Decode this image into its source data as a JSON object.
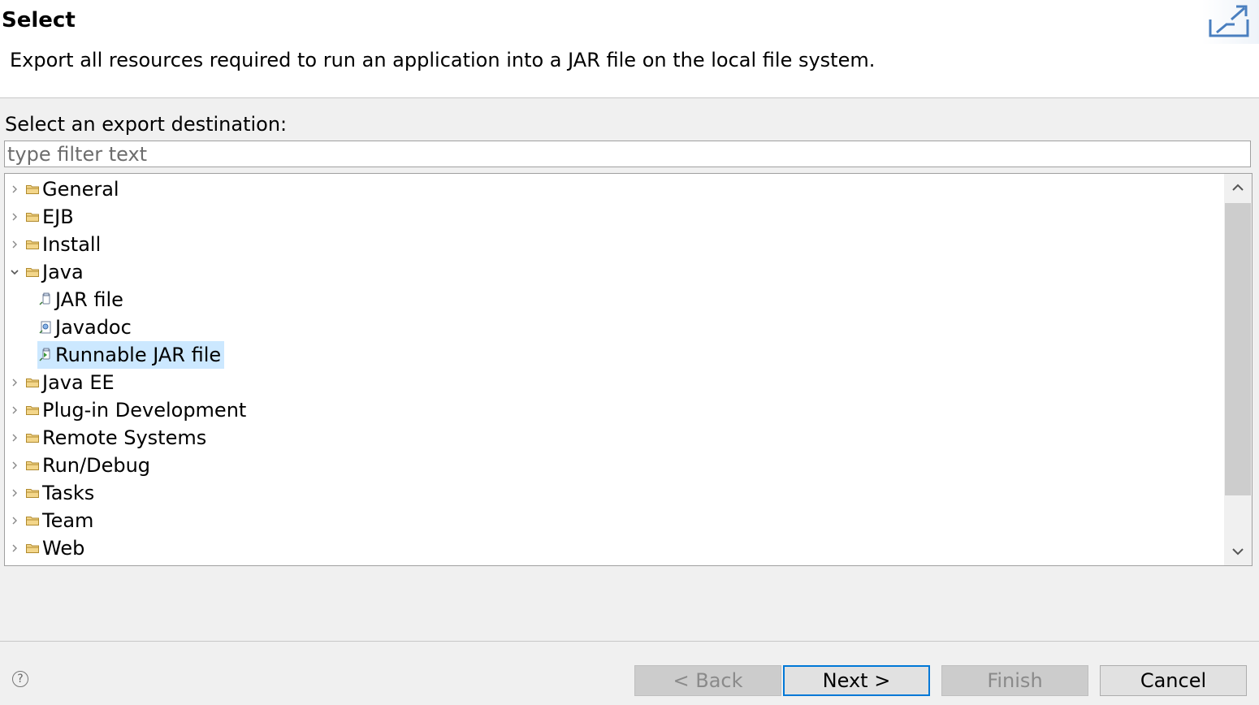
{
  "header": {
    "title": "Select",
    "description": "Export all resources required to run an application into a JAR file on the local file system."
  },
  "prompt": "Select an export destination:",
  "filter": {
    "placeholder": "type filter text",
    "value": ""
  },
  "tree": {
    "items": [
      {
        "label": "General",
        "expanded": false
      },
      {
        "label": "EJB",
        "expanded": false
      },
      {
        "label": "Install",
        "expanded": false
      },
      {
        "label": "Java",
        "expanded": true,
        "children": [
          {
            "label": "JAR file",
            "icon": "jar-icon"
          },
          {
            "label": "Javadoc",
            "icon": "javadoc-icon"
          },
          {
            "label": "Runnable JAR file",
            "icon": "runnable-jar-icon",
            "selected": true
          }
        ]
      },
      {
        "label": "Java EE",
        "expanded": false
      },
      {
        "label": "Plug-in Development",
        "expanded": false
      },
      {
        "label": "Remote Systems",
        "expanded": false
      },
      {
        "label": "Run/Debug",
        "expanded": false
      },
      {
        "label": "Tasks",
        "expanded": false
      },
      {
        "label": "Team",
        "expanded": false
      },
      {
        "label": "Web",
        "expanded": false
      }
    ]
  },
  "buttons": {
    "back": "< Back",
    "next": "Next >",
    "finish": "Finish",
    "cancel": "Cancel"
  },
  "help_symbol": "?",
  "colors": {
    "selection": "#cce8ff",
    "default_button_border": "#0078d7",
    "folder": "#e8c26a"
  }
}
